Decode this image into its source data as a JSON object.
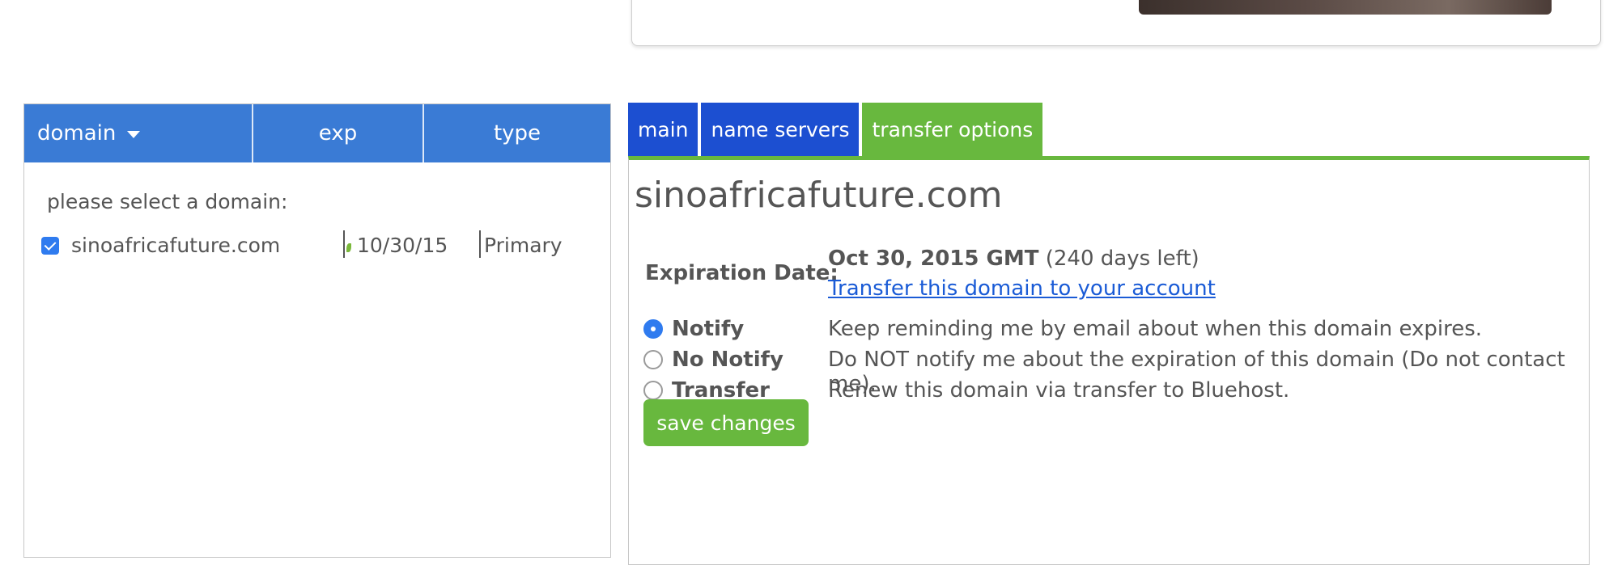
{
  "domain_list": {
    "columns": {
      "domain": "domain",
      "exp": "exp",
      "type": "type"
    },
    "prompt": "please select a domain:",
    "rows": [
      {
        "domain": "sinoafricafuture.com",
        "exp": "10/30/15",
        "type": "Primary",
        "checked": true
      }
    ]
  },
  "tabs": [
    {
      "label": "main",
      "active": false
    },
    {
      "label": "name servers",
      "active": false
    },
    {
      "label": "transfer options",
      "active": true
    }
  ],
  "detail": {
    "domain_title": "sinoafricafuture.com",
    "expiration_label": "Expiration Date:",
    "expiration_date": "Oct 30, 2015 GMT",
    "days_left": "(240 days left)",
    "transfer_link": "Transfer this domain to your account",
    "options": [
      {
        "label": "Notify",
        "description": "Keep reminding me by email about when this domain expires.",
        "selected": true
      },
      {
        "label": "No Notify",
        "description": "Do NOT notify me about the expiration of this domain (Do not contact me).",
        "selected": false
      },
      {
        "label": "Transfer",
        "description": "Renew this domain via transfer to Bluehost.",
        "selected": false
      }
    ],
    "save_label": "save changes"
  },
  "colors": {
    "header_blue": "#3a7bd5",
    "tab_blue": "#1c4fd1",
    "accent_green": "#68b83e",
    "link_blue": "#1a5bd6"
  }
}
